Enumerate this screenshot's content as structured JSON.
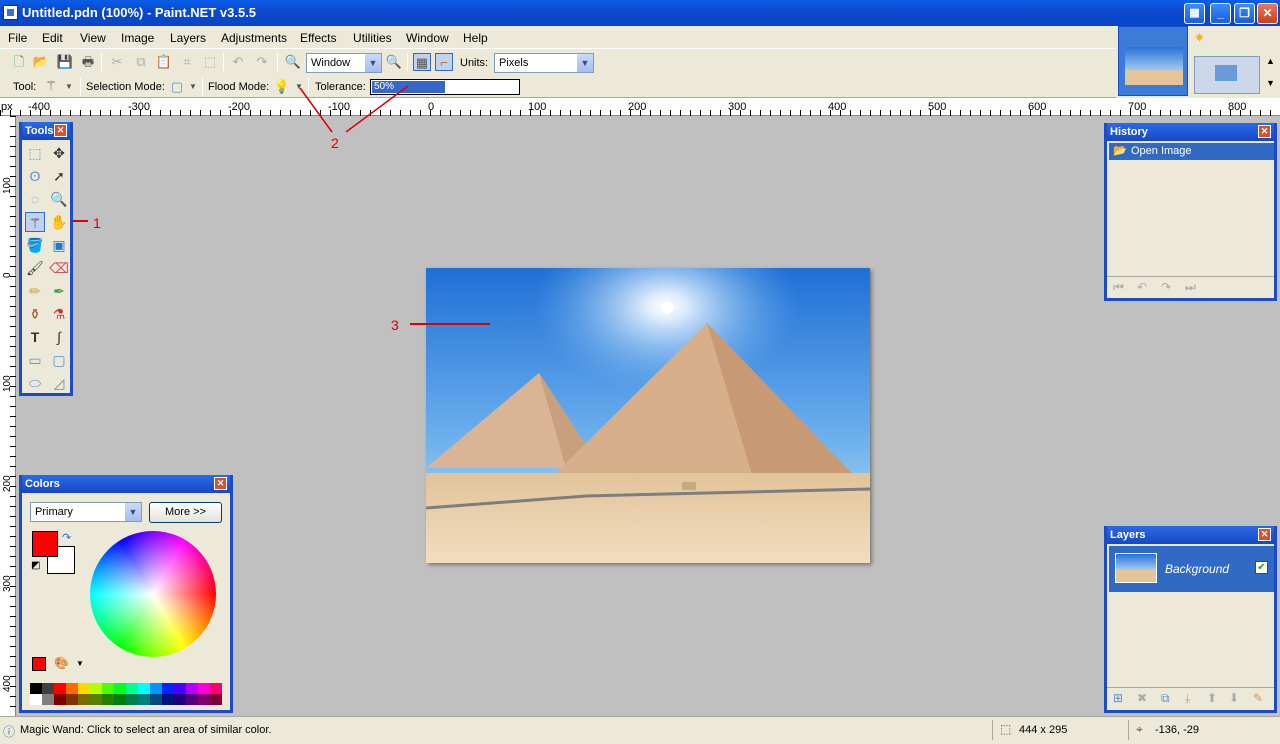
{
  "window": {
    "title": "Untitled.pdn (100%) - Paint.NET v3.5.5"
  },
  "menu": [
    "File",
    "Edit",
    "View",
    "Image",
    "Layers",
    "Adjustments",
    "Effects",
    "Utilities",
    "Window",
    "Help"
  ],
  "toolbar": {
    "zoom_value": "Window",
    "units_label": "Units:",
    "units_value": "Pixels"
  },
  "toolbar2": {
    "tool_label": "Tool:",
    "selection_mode_label": "Selection Mode:",
    "flood_mode_label": "Flood Mode:",
    "tolerance_label": "Tolerance:",
    "tolerance_value": "50%",
    "tolerance_level": 0.5
  },
  "ruler": {
    "unit": "px",
    "top": [
      "-400",
      "-300",
      "-200",
      "-100",
      "0",
      "100",
      "200",
      "300",
      "400",
      "500",
      "600",
      "700",
      "800"
    ],
    "left": [
      "100",
      "0",
      "100",
      "200",
      "300",
      "400"
    ]
  },
  "tools_panel": {
    "title": "Tools"
  },
  "history_panel": {
    "title": "History",
    "items": [
      "Open Image"
    ]
  },
  "layers_panel": {
    "title": "Layers",
    "layers": [
      {
        "name": "Background",
        "visible": true
      }
    ]
  },
  "colors_panel": {
    "title": "Colors",
    "mode": "Primary",
    "more_button": "More >>",
    "primary": "#ff0000",
    "secondary": "#ffffff"
  },
  "status": {
    "message": "Magic Wand: Click to select an area of similar color.",
    "size": "444 x 295",
    "cursor": "-136, -29"
  },
  "annotations": [
    "1",
    "2",
    "3"
  ],
  "colors": {
    "titlebar": "#0a5de8",
    "accent": "#316ac5",
    "annotation": "#dd0000"
  }
}
